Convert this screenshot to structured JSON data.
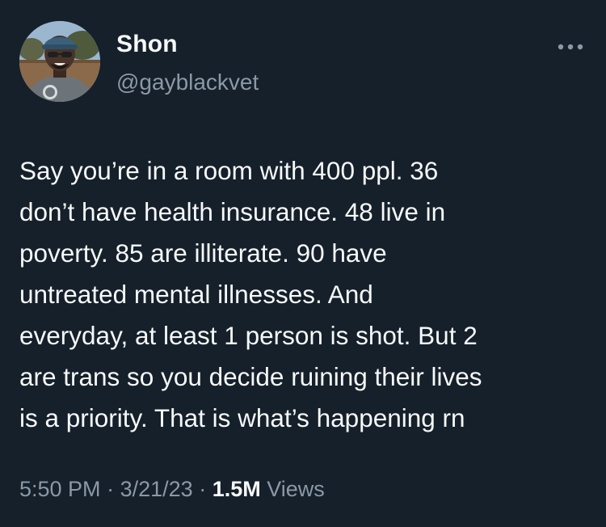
{
  "author": {
    "name": "Shon",
    "handle": "@gayblackvet",
    "avatar_icon": "profile-photo"
  },
  "more_icon": "more-horizontal-icon",
  "tweet": {
    "text": "Say you’re in a room with 400 ppl. 36\ndon’t have health insurance. 48 live in\npoverty. 85 are illiterate. 90 have\nuntreated mental illnesses. And\neveryday, at least 1 person is shot. But 2\nare trans so you decide ruining their lives\nis a priority. That is what’s happening rn"
  },
  "meta": {
    "time": "5:50 PM",
    "separator": "·",
    "date": "3/21/23",
    "views_count": "1.5M",
    "views_label": "Views"
  },
  "colors": {
    "background": "#15202b",
    "primary_text": "#f7f9f9",
    "secondary_text": "#8b98a5"
  }
}
